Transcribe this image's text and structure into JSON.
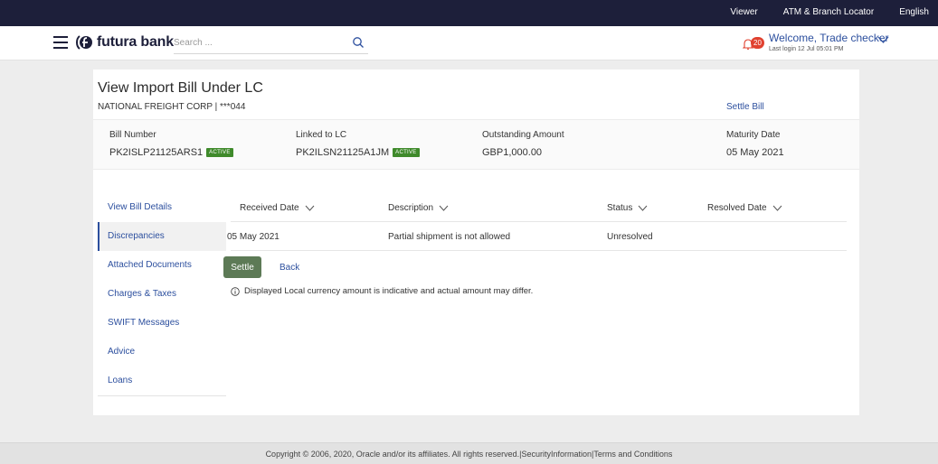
{
  "topbar": {
    "viewer": "Viewer",
    "atm": "ATM & Branch Locator",
    "language": "English"
  },
  "header": {
    "brand": "futura bank",
    "search_placeholder": "Search ...",
    "notification_count": "20",
    "welcome": "Welcome, Trade checker",
    "last_login": "Last login 12 Jul 05:01 PM"
  },
  "page": {
    "title": "View Import Bill Under LC",
    "subtitle": "NATIONAL FREIGHT CORP | ***044",
    "settle_bill": "Settle Bill"
  },
  "summary": {
    "bill_number_label": "Bill Number",
    "bill_number": "PK2ISLP21125ARS1",
    "bill_status": "ACTIVE",
    "linked_lc_label": "Linked to LC",
    "linked_lc": "PK2ILSN21125A1JM",
    "lc_status": "ACTIVE",
    "outstanding_label": "Outstanding Amount",
    "outstanding": "GBP1,000.00",
    "maturity_label": "Maturity Date",
    "maturity": "05 May 2021"
  },
  "sidenav": [
    {
      "label": "View Bill Details"
    },
    {
      "label": "Discrepancies"
    },
    {
      "label": "Attached Documents"
    },
    {
      "label": "Charges & Taxes"
    },
    {
      "label": "SWIFT Messages"
    },
    {
      "label": "Advice"
    },
    {
      "label": "Loans"
    }
  ],
  "table": {
    "columns": [
      "Received Date",
      "Description",
      "Status",
      "Resolved Date"
    ],
    "rows": [
      {
        "received": "05 May 2021",
        "description": "Partial shipment is not allowed",
        "status": "Unresolved",
        "resolved": ""
      }
    ]
  },
  "actions": {
    "settle": "Settle",
    "back": "Back"
  },
  "note": "Displayed Local currency amount is indicative and actual amount may differ.",
  "footer": "Copyright © 2006, 2020, Oracle and/or its affiliates. All rights reserved.|SecurityInformation|Terms and Conditions",
  "colors": {
    "topbar": "#1d1f3a",
    "link": "#2c4f9e",
    "active_tag": "#3f8a2b",
    "settle_button": "#5d7a56",
    "badge": "#e0412f"
  }
}
